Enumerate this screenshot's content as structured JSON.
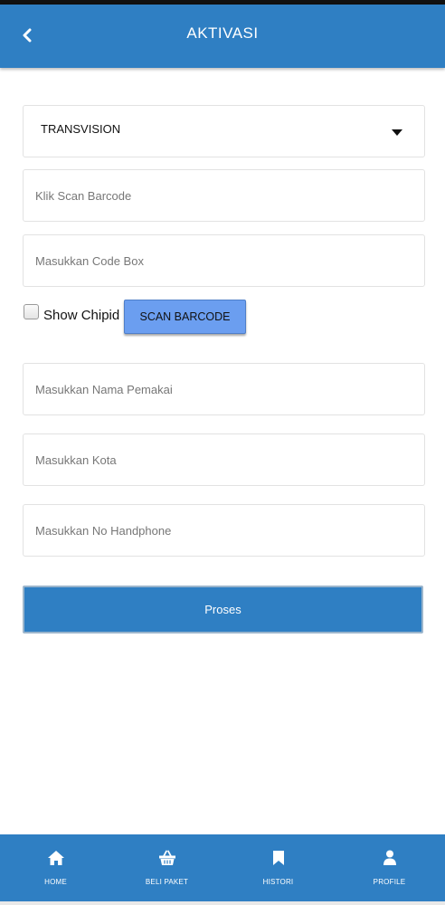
{
  "header": {
    "title": "AKTIVASI",
    "back_icon": "chevron-left-icon"
  },
  "form": {
    "provider_select": {
      "value": "TRANSVISION",
      "icon": "caret-down-icon"
    },
    "barcode_field": {
      "placeholder": "Klik Scan Barcode",
      "value": ""
    },
    "codebox_field": {
      "placeholder": "Masukkan Code Box",
      "value": ""
    },
    "show_chipid": {
      "label": "Show Chipid",
      "checked": false
    },
    "scan_button_label": "SCAN BARCODE",
    "name_field": {
      "placeholder": "Masukkan Nama Pemakai",
      "value": ""
    },
    "city_field": {
      "placeholder": "Masukkan Kota",
      "value": ""
    },
    "phone_field": {
      "placeholder": "Masukkan No Handphone",
      "value": ""
    },
    "submit_label": "Proses"
  },
  "bottom_nav": {
    "items": [
      {
        "label": "HOME",
        "icon": "home-icon"
      },
      {
        "label": "BELI PAKET",
        "icon": "basket-icon"
      },
      {
        "label": "HISTORI",
        "icon": "bookmark-icon"
      },
      {
        "label": "PROFILE",
        "icon": "user-icon"
      }
    ]
  },
  "colors": {
    "primary": "#2f7fc3",
    "scan_button": "#6b9ef0",
    "background": "#ffffff"
  }
}
